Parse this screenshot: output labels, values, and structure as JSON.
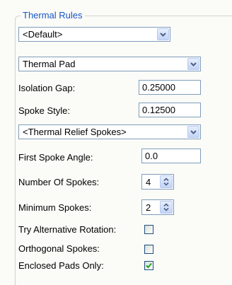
{
  "group": {
    "title": "Thermal Rules"
  },
  "rule_select": {
    "value": "<Default>"
  },
  "type_select": {
    "value": "Thermal Pad"
  },
  "isolation_gap": {
    "label": "Isolation Gap:",
    "value": "0.25000"
  },
  "spoke_style": {
    "label": "Spoke Style:",
    "value": "0.12500"
  },
  "relief_select": {
    "value": "<Thermal Relief Spokes>"
  },
  "first_spoke_angle": {
    "label": "First Spoke Angle:",
    "value": "0.0"
  },
  "number_of_spokes": {
    "label": "Number Of Spokes:",
    "value": "4"
  },
  "minimum_spokes": {
    "label": "Minimum Spokes:",
    "value": "2"
  },
  "try_alternative_rotation": {
    "label": "Try Alternative Rotation:",
    "checked": false
  },
  "orthogonal_spokes": {
    "label": "Orthogonal Spokes:",
    "checked": false
  },
  "enclosed_pads_only": {
    "label": "Enclosed Pads Only:",
    "checked": true
  },
  "icons": {
    "dropdown": "chevron-down-icon",
    "spinner": "spin-up-down-icon",
    "check": "check-icon"
  },
  "colors": {
    "legend_text": "#1656c4",
    "group_border": "#d5d2c6",
    "field_border": "#7f9db9",
    "button_border": "#b7caf2",
    "arrow": "#4d6185",
    "check": "#21a121",
    "background": "#fbfbf8"
  }
}
